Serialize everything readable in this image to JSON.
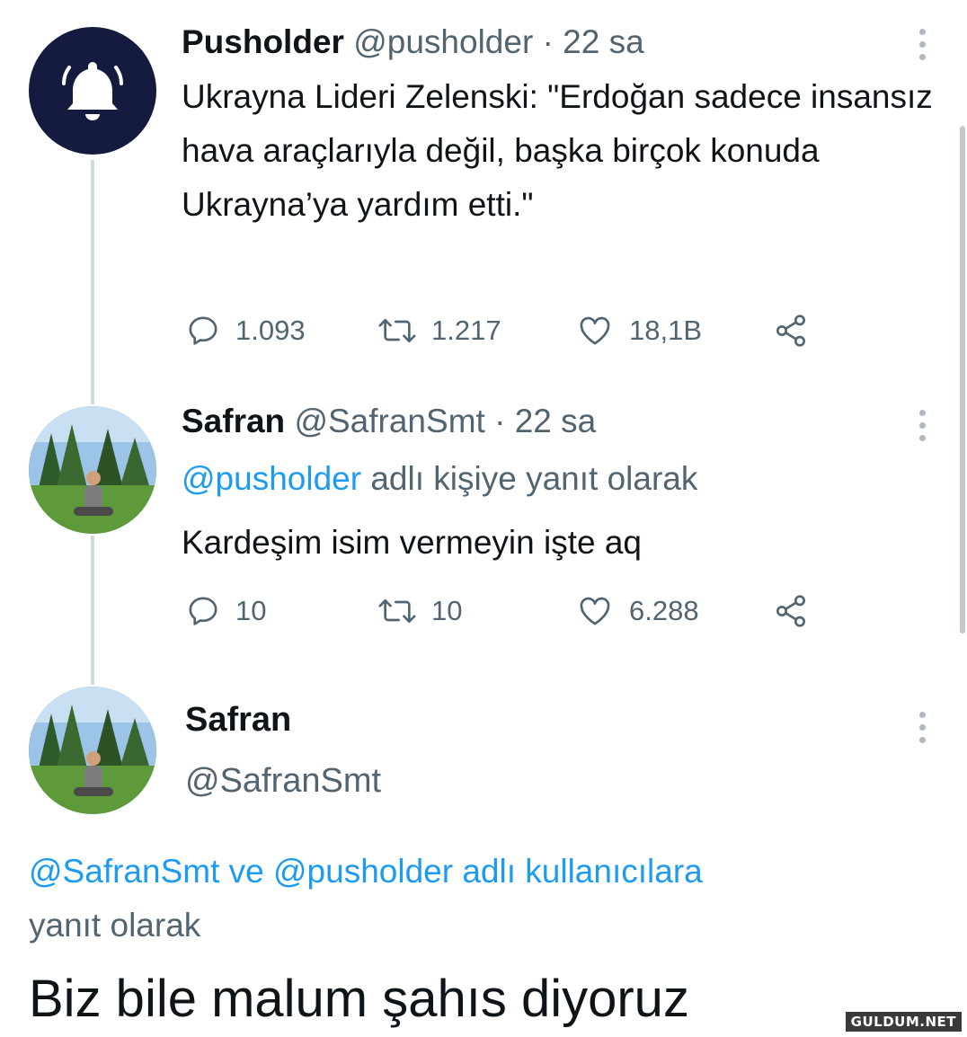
{
  "tweet1": {
    "avatar_icon": "bell-icon",
    "name": "Pusholder",
    "handle": "@pusholder",
    "dot": "·",
    "time": "22 sa",
    "text": "Ukrayna Lideri Zelenski: \"Erdoğan sadece insansız hava araçlarıyla değil, başka birçok konuda Ukrayna’ya yardım etti.\"",
    "replies": "1.093",
    "retweets": "1.217",
    "likes": "18,1B"
  },
  "tweet2": {
    "name": "Safran",
    "handle": "@SafranSmt",
    "dot": "·",
    "time": "22 sa",
    "reply_to_handle": "@pusholder",
    "reply_to_suffix": " adlı kişiye yanıt olarak",
    "text": "Kardeşim isim vermeyin işte aq",
    "replies": "10",
    "retweets": "10",
    "likes": "6.288"
  },
  "main_tweet": {
    "name": "Safran",
    "handle": "@SafranSmt",
    "reply_handle_1": "@SafranSmt",
    "reply_and": " ve ",
    "reply_handle_2": "@pusholder",
    "reply_suffix_1": " adlı kullanıcılara",
    "reply_suffix_2": "yanıt olarak",
    "text": "Biz bile malum şahıs diyoruz"
  },
  "watermark": "GULDUM.NET",
  "colors": {
    "link": "#1d9bf0",
    "secondary_text": "#536471",
    "bell_avatar_bg": "#141b3e",
    "thread_line": "#cfd9de"
  }
}
